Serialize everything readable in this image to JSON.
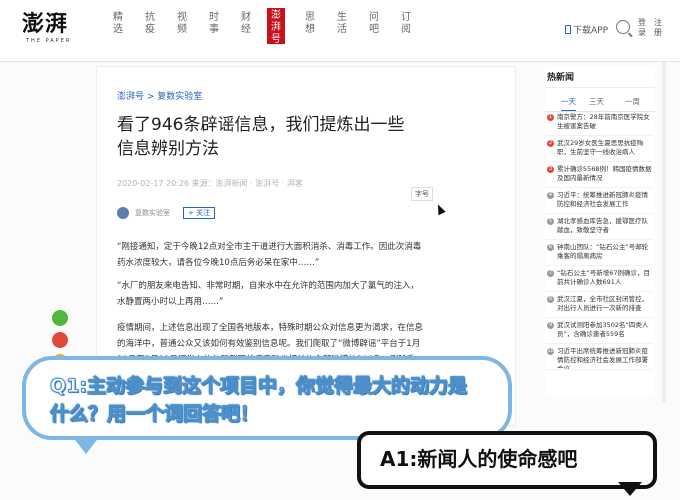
{
  "header": {
    "logo": "澎湃",
    "logo_sub": "THE PAPER",
    "nav": [
      "精选",
      "抗疫",
      "视频",
      "时事",
      "财经",
      "澎湃号",
      "思想",
      "生活",
      "问吧",
      "订阅"
    ],
    "active_nav": "澎湃号",
    "download": "下载APP",
    "login": "登录",
    "register": "注册"
  },
  "article": {
    "breadcrumb": "澎湃号 > 复数实验室",
    "title": "看了946条辟谣信息，我们提炼出一些信息辨别方法",
    "meta": "2020-02-17 20:26 来源：澎湃新闻 · 澎湃号 · 湃客",
    "font_button": "字号",
    "author": "复数实验室",
    "follow": "+ 关注",
    "paragraphs": [
      "“刚接通知，定于今晚12点对全市主干道进行大面积消杀、消毒工作。因此次消毒药水浓度较大，请各位今晚10点后务必呆在家中……”",
      "“水厂的朋友来电告知、非常时期，自来水中在允许的范围内加大了氯气的注入，水静置两小时以上再用……”",
      "疫情期间，上述信息出现了全国各地版本，特殊时期公众对信息更为渴求，在信息的海洋中，普通公众又该如何有效鉴别信息呢。我们爬取了“微博辟谣”平台于1月20日至2月11日间发布的与新型冠状病毒肺炎相关的全部微博共804条，删除重"
    ]
  },
  "hot_news": {
    "title": "热新闻",
    "tabs": [
      "一天",
      "三天",
      "一周"
    ],
    "items": [
      "南京警方：28年前南京医学院女生被害案告破",
      "武汉29岁女医生夏思思抗疫殉职，生前坚守一线收治病人",
      "累计确诊5568例！韩国疫情数据及国内最新情况",
      "习近平：统筹推进新冠肺炎疫情防控和经济社会发展工作",
      "湖北孝感血库告急，援鄂医疗队献血，致敬坚守者",
      "钟南山团队：“钻石公主”号邮轮乘客的隔离病房",
      "“钻石公主”号新增67例确诊，目前共计确诊人数691人",
      "武汉江夏，全市社区封闭管控，对出行人员进行一次新的排查",
      "武汉试测阳参加3502名“四类人员”，含确诊患者559名",
      "习近平出席统筹推进新冠肺炎疫情防控和经济社会发展工作部署会议"
    ]
  },
  "overlay": {
    "question": "Q1:主动参与到这个项目中，你觉得最大的动力是什么？用一个词回答吧！",
    "answer": "A1:新闻人的使命感吧"
  }
}
